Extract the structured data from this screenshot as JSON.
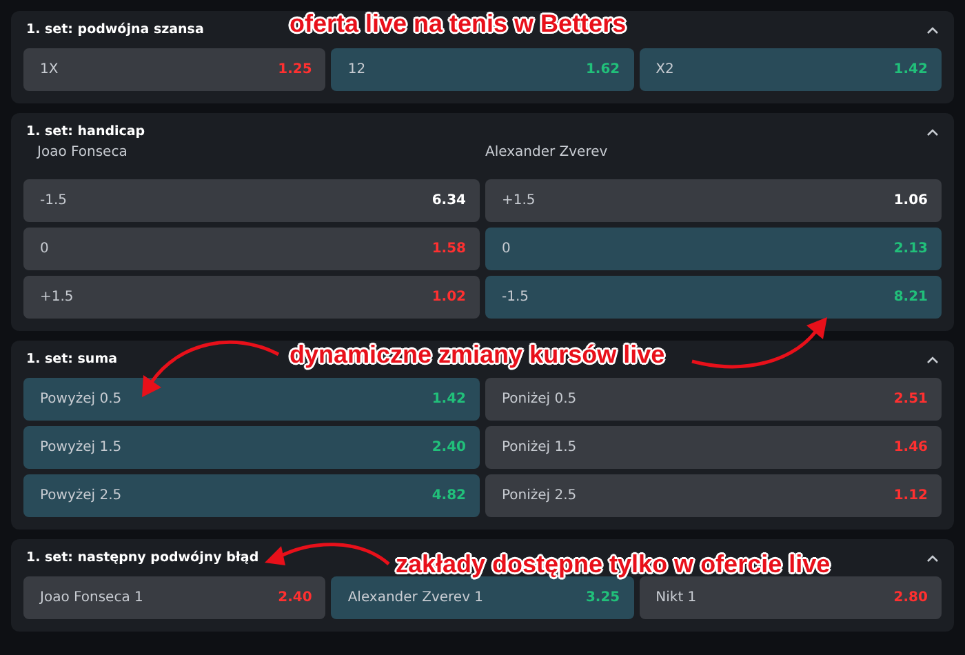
{
  "markets": [
    {
      "title": "1. set: podwójna szansa",
      "expanded": true,
      "odds": [
        {
          "label": "1X",
          "price": "1.25",
          "kind": "down"
        },
        {
          "label": "12",
          "price": "1.62",
          "kind": "up"
        },
        {
          "label": "X2",
          "price": "1.42",
          "kind": "up"
        }
      ]
    },
    {
      "title": "1. set: handicap",
      "expanded": true,
      "players": [
        "Joao Fonseca",
        "Alexander Zverev"
      ],
      "odds": [
        {
          "label": "-1.5",
          "price": "6.34",
          "kind": "steady"
        },
        {
          "label": "+1.5",
          "price": "1.06",
          "kind": "steady"
        },
        {
          "label": "0",
          "price": "1.58",
          "kind": "down"
        },
        {
          "label": "0",
          "price": "2.13",
          "kind": "up"
        },
        {
          "label": "+1.5",
          "price": "1.02",
          "kind": "down"
        },
        {
          "label": "-1.5",
          "price": "8.21",
          "kind": "up"
        }
      ]
    },
    {
      "title": "1. set: suma",
      "expanded": true,
      "odds": [
        {
          "label": "Powyżej 0.5",
          "price": "1.42",
          "kind": "up"
        },
        {
          "label": "Poniżej 0.5",
          "price": "2.51",
          "kind": "down"
        },
        {
          "label": "Powyżej 1.5",
          "price": "2.40",
          "kind": "up"
        },
        {
          "label": "Poniżej 1.5",
          "price": "1.46",
          "kind": "down"
        },
        {
          "label": "Powyżej 2.5",
          "price": "4.82",
          "kind": "up"
        },
        {
          "label": "Poniżej 2.5",
          "price": "1.12",
          "kind": "down"
        }
      ]
    },
    {
      "title": "1. set: następny podwójny błąd",
      "expanded": true,
      "odds": [
        {
          "label": "Joao Fonseca 1",
          "price": "2.40",
          "kind": "down"
        },
        {
          "label": "Alexander Zverev 1",
          "price": "3.25",
          "kind": "up"
        },
        {
          "label": "Nikt 1",
          "price": "2.80",
          "kind": "down"
        }
      ]
    }
  ],
  "annotations": [
    "oferta live na tenis w Betters",
    "dynamiczne zmiany kursów live",
    "zakłady dostępne tylko w ofercie live"
  ]
}
